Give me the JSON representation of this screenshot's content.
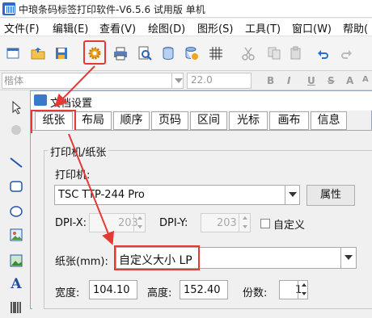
{
  "window": {
    "title": "中琅条码标签打印软件-V6.5.6 试用版 单机"
  },
  "menu": [
    "文件(F)",
    "编辑(E)",
    "查看(V)",
    "绘图(D)",
    "图形(S)",
    "工具(T)",
    "窗口(W)",
    "帮助("
  ],
  "toolbar": {
    "icons": [
      "new-icon",
      "open-icon",
      "save-icon",
      "settings-icon",
      "print-icon",
      "print-preview-icon",
      "database-icon",
      "database-settings-icon",
      "grid-icon",
      "cut-icon",
      "copy-icon",
      "paste-icon",
      "undo-icon",
      "redo-icon"
    ]
  },
  "fontbar": {
    "font_name": "楷体",
    "font_size": "22.0",
    "format_buttons": [
      "B",
      "I",
      "U",
      "S",
      "A",
      "A"
    ]
  },
  "toolbox": {
    "icons": [
      "pointer-icon",
      "magic-icon",
      "line-icon",
      "rounded-rect-icon",
      "ellipse-icon",
      "image-icon",
      "picture-icon",
      "text-icon",
      "barcode-icon"
    ],
    "text_tool_label": "A"
  },
  "dialog": {
    "title": "文档设置",
    "tabs": [
      "纸张",
      "布局",
      "顺序",
      "页码",
      "区间",
      "光标",
      "画布",
      "信息"
    ],
    "group_title": "打印机/纸张",
    "printer_label": "打印机:",
    "printer_value": "TSC TTP-244 Pro",
    "attr_button": "属性",
    "dpi_x_label": "DPI-X:",
    "dpi_x_value": "203",
    "dpi_y_label": "DPI-Y:",
    "dpi_y_value": "203",
    "custom_label": "自定义",
    "paper_label": "纸张(mm):",
    "paper_value": "自定义大小 LP",
    "width_label": "宽度:",
    "width_value": "104.10",
    "height_label": "高度:",
    "height_value": "152.40",
    "copies_label": "份数:",
    "copies_value": "1"
  },
  "colors": {
    "highlight": "#e53935",
    "accent": "#2a6bd1"
  }
}
